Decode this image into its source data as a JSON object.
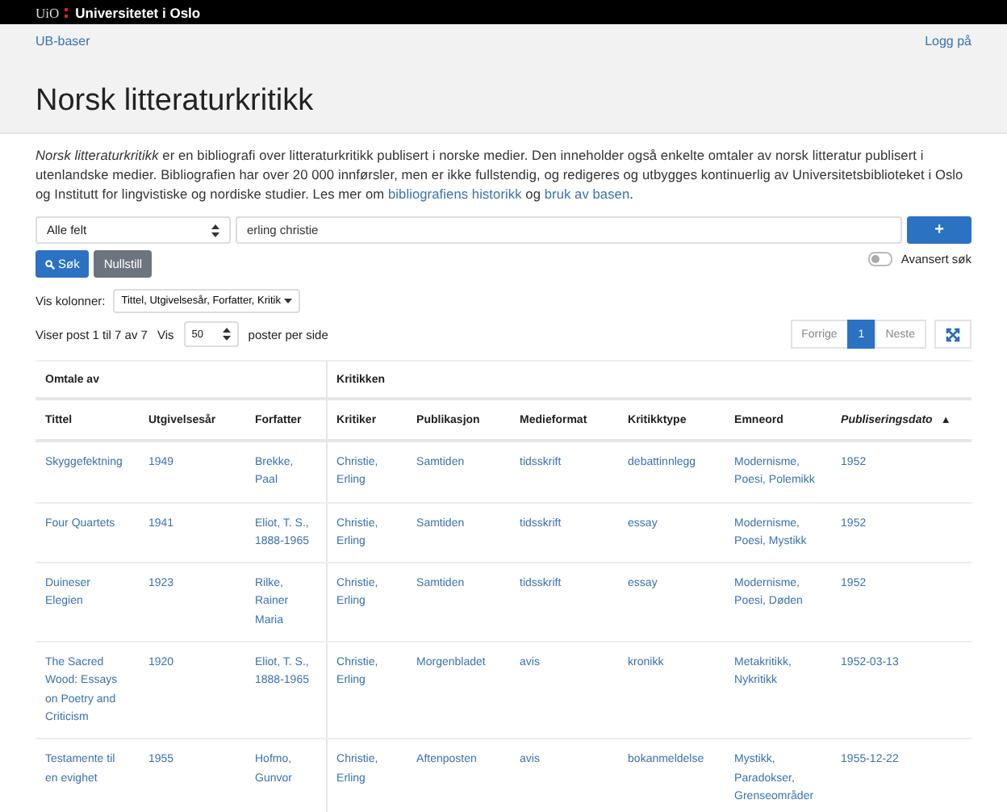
{
  "topbar": {
    "logo_mark": "UiO",
    "logo_text": "Universitetet i Oslo"
  },
  "nav": {
    "left_link": "UB-baser",
    "right_link": "Logg på"
  },
  "title": "Norsk litteraturkritikk",
  "description": [
    {
      "kind": "text",
      "text": "*Norsk litteraturkritikk* er en bibliografi over litteraturkritikk publisert i norske medier. Den inneholder også enkelte omtaler av norsk litteratur publisert i utenlandske medier. Bibliografien har over 20 000 innførsler, men er ikke fullstendig, og redigeres og utbygges kontinuerlig av Universitetsbiblioteket i Oslo og Institutt for lingvistiske og nordiske studier. Les mer om "
    },
    {
      "kind": "link",
      "text": "bibliografiens historikk"
    },
    {
      "kind": "text",
      "text": " og "
    },
    {
      "kind": "link",
      "text": "bruk av basen"
    },
    {
      "kind": "text",
      "text": "."
    }
  ],
  "search": {
    "field_select": "Alle felt",
    "value": "erling christie",
    "add_button": "+",
    "search_button": "Søk",
    "reset_button": "Nullstill",
    "advanced": {
      "label": "Avansert søk",
      "on": false
    }
  },
  "columns_picker": {
    "label": "Vis kolonner:",
    "value": "Tittel, Utgivelsesår, Forfatter, Kritik"
  },
  "listing": {
    "summary": "Viser post 1 til 7 av 7",
    "show_label": "Vis",
    "per_page": "50",
    "per_page_suffix": "poster per side"
  },
  "pagination": {
    "previous": "Forrige",
    "pages": [
      {
        "label": "1",
        "selected": true
      }
    ],
    "next": "Neste"
  },
  "table": {
    "groups": [
      {
        "label": "Omtale av"
      },
      {
        "label": "Kritikken"
      }
    ],
    "columns": [
      {
        "label": "Tittel",
        "sorted": false
      },
      {
        "label": "Utgivelsesår",
        "sorted": false
      },
      {
        "label": "Forfatter",
        "sorted": false
      },
      {
        "label": "Kritiker",
        "sorted": false
      },
      {
        "label": "Publikasjon",
        "sorted": false
      },
      {
        "label": "Medieformat",
        "sorted": false
      },
      {
        "label": "Kritikktype",
        "sorted": false
      },
      {
        "label": "Emneord",
        "sorted": false
      },
      {
        "label": "Publiseringsdato",
        "sorted": true,
        "sort_indicator": "▲"
      }
    ],
    "rows": [
      [
        "Skyggefektning",
        "1949",
        "Brekke, Paal",
        "Christie, Erling",
        "Samtiden",
        "tidsskrift",
        "debattinnlegg",
        "Modernisme, Poesi, Polemikk",
        "1952"
      ],
      [
        "Four Quartets",
        "1941",
        "Eliot, T. S., 1888-1965",
        "Christie, Erling",
        "Samtiden",
        "tidsskrift",
        "essay",
        "Modernisme, Poesi, Mystikk",
        "1952"
      ],
      [
        "Duineser Elegien",
        "1923",
        "Rilke, Rainer Maria",
        "Christie, Erling",
        "Samtiden",
        "tidsskrift",
        "essay",
        "Modernisme, Poesi, Døden",
        "1952"
      ],
      [
        "The Sacred Wood: Essays on Poetry and Criticism",
        "1920",
        "Eliot, T. S., 1888-1965",
        "Christie, Erling",
        "Morgenbladet",
        "avis",
        "kronikk",
        "Metakritikk, Nykritikk",
        "1952-03-13"
      ],
      [
        "Testamente til en evighet",
        "1955",
        "Hofmo, Gunvor",
        "Christie, Erling",
        "Aftenposten",
        "avis",
        "bokanmeldelse",
        "Mystikk, Paradokser, Grenseområder",
        "1955-12-22"
      ]
    ]
  }
}
